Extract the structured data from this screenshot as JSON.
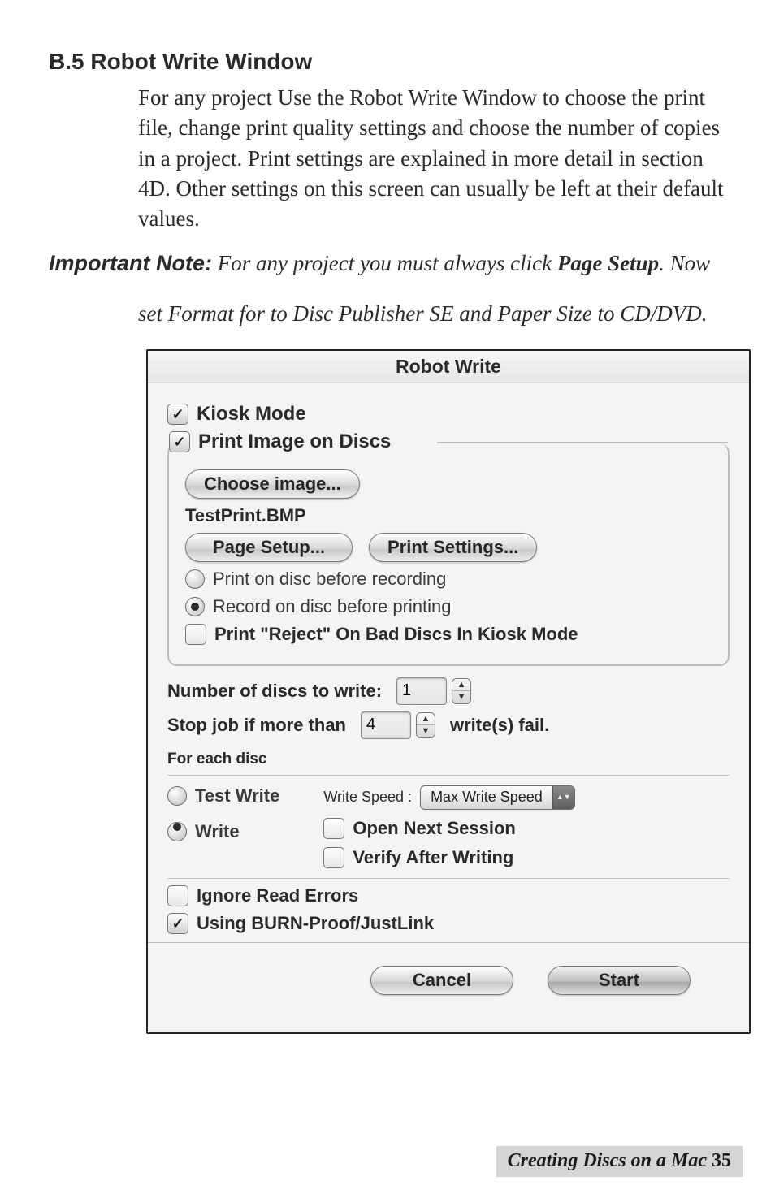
{
  "heading": "B.5 Robot Write Window",
  "paragraph": "For any project Use the Robot Write Window to choose the print file, change print quality settings and choose the number of copies in a project. Print settings are explained in more detail in section 4D. Other settings on this screen can usually be left at their default values.",
  "note": {
    "label": "Important Note:",
    "text1": " For any project you must always click ",
    "bold": "Page Setup",
    "text2": ". Now",
    "text3": "set Format for to Disc Publisher SE and Paper Size to CD/DVD."
  },
  "dialog": {
    "title": "Robot Write",
    "kiosk_label": "Kiosk Mode",
    "print_image_label": "Print Image on Discs",
    "choose_image_btn": "Choose image...",
    "file_name": "TestPrint.BMP",
    "page_setup_btn": "Page Setup...",
    "print_settings_btn": "Print Settings...",
    "radio_print_first": "Print on disc before recording",
    "radio_record_first": "Record on disc before printing",
    "reject_label": "Print \"Reject\" On Bad Discs In Kiosk Mode",
    "num_discs_label": "Number of discs to write:",
    "num_discs_value": "1",
    "stop_job_label": "Stop job if more than",
    "stop_job_value": "4",
    "writes_fail": "write(s) fail.",
    "for_each_disc": "For each disc",
    "radio_test_write": "Test Write",
    "radio_write": "Write",
    "write_speed_label": "Write Speed :",
    "write_speed_value": "Max Write Speed",
    "open_next_session": "Open Next Session",
    "verify_after_writing": "Verify After Writing",
    "ignore_read_errors": "Ignore Read Errors",
    "burn_proof": "Using BURN-Proof/JustLink",
    "cancel_btn": "Cancel",
    "start_btn": "Start"
  },
  "footer": {
    "text": "Creating Discs on a Mac",
    "page": "35"
  }
}
